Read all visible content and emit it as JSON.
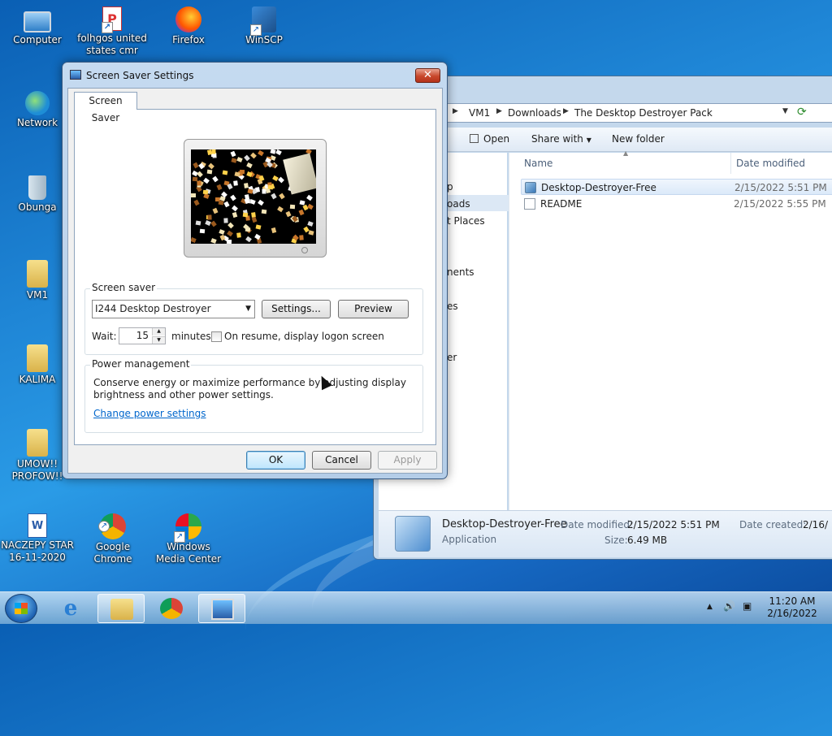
{
  "desktop": {
    "icons": [
      {
        "label": "Computer"
      },
      {
        "label": "folhgos united states cmr"
      },
      {
        "label": "Firefox"
      },
      {
        "label": "WinSCP"
      },
      {
        "label": "Network"
      },
      {
        "label": "Obunga"
      },
      {
        "label": "VM1"
      },
      {
        "label": "KALIMA"
      },
      {
        "label": "UMOW!! PROFOW!!"
      },
      {
        "label": "NACZEPY STAR 16-11-2020"
      },
      {
        "label": "Google Chrome"
      },
      {
        "label": "Windows Media Center"
      }
    ]
  },
  "explorer": {
    "breadcrumb": [
      "VM1",
      "Downloads",
      "The Desktop Destroyer Pack"
    ],
    "toolbar": {
      "open": "Open",
      "share_with": "Share with",
      "new_folder": "New folder"
    },
    "nav_items": [
      "p",
      "oads",
      "t Places",
      "nents",
      "es",
      "er"
    ],
    "columns": {
      "name": "Name",
      "date_modified": "Date modified"
    },
    "files": [
      {
        "name": "Desktop-Destroyer-Free",
        "date": "2/15/2022 5:51 PM"
      },
      {
        "name": "README",
        "date": "2/15/2022 5:55 PM"
      }
    ],
    "details": {
      "name": "Desktop-Destroyer-Free",
      "type": "Application",
      "date_modified_label": "Date modified:",
      "date_modified": "2/15/2022 5:51 PM",
      "size_label": "Size:",
      "size": "6.49 MB",
      "date_created_label": "Date created:",
      "date_created": "2/16/"
    }
  },
  "dialog": {
    "title": "Screen Saver Settings",
    "close": "✕",
    "tab": "Screen Saver",
    "screensaver_group": "Screen saver",
    "selected_screensaver": "I244 Desktop Destroyer",
    "settings_button": "Settings...",
    "preview_button": "Preview",
    "wait_label": "Wait:",
    "wait_value": "15",
    "minutes_label": "minutes",
    "resume_label": "On resume, display logon screen",
    "power_group": "Power management",
    "power_text_1": "Conserve energy or maximize performance by adjusting display",
    "power_text_2": "brightness and other power settings.",
    "power_link": "Change power settings",
    "ok": "OK",
    "cancel": "Cancel",
    "apply": "Apply"
  },
  "taskbar": {
    "time": "11:20 AM",
    "date": "2/16/2022"
  }
}
